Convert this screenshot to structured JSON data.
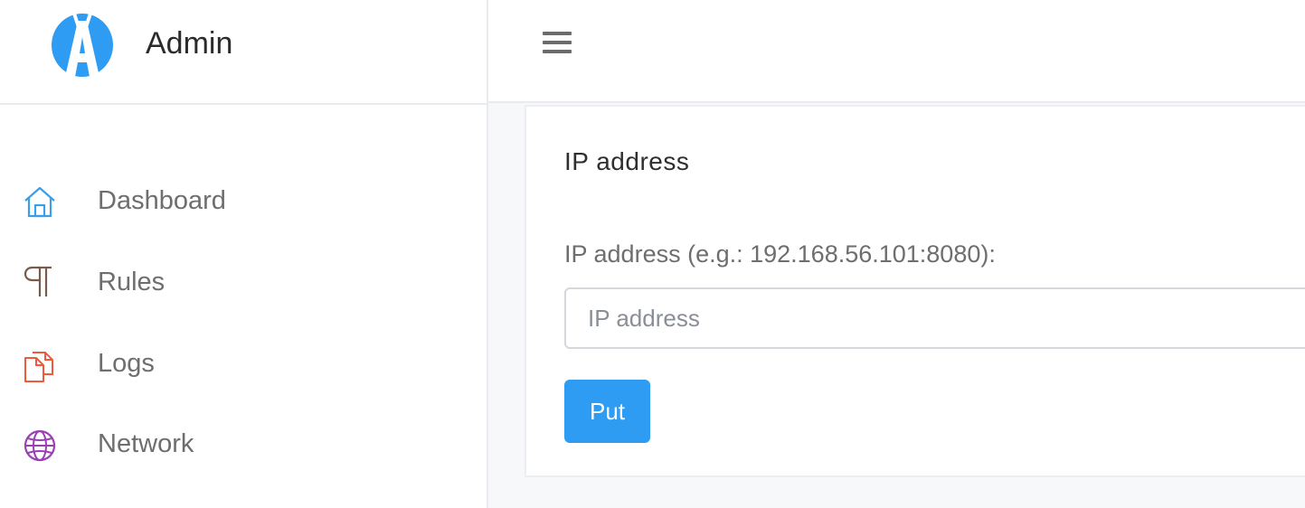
{
  "brand": {
    "name": "Admin",
    "logo_letter": "A",
    "logo_color": "#2d9cf2"
  },
  "sidebar": {
    "items": [
      {
        "label": "Dashboard",
        "icon": "home-icon",
        "color": "#3a9ee8"
      },
      {
        "label": "Rules",
        "icon": "pilcrow-icon",
        "color": "#7a5a4a"
      },
      {
        "label": "Logs",
        "icon": "files-icon",
        "color": "#f05a3a"
      },
      {
        "label": "Network",
        "icon": "globe-icon",
        "color": "#9b3fb5"
      }
    ]
  },
  "topbar": {
    "menu_icon": "hamburger-icon"
  },
  "card": {
    "title": "IP address",
    "field_label": "IP address (e.g.: 192.168.56.101:8080):",
    "input_value": "",
    "input_placeholder": "IP address",
    "button_label": "Put",
    "button_color": "#2d9cf2"
  }
}
